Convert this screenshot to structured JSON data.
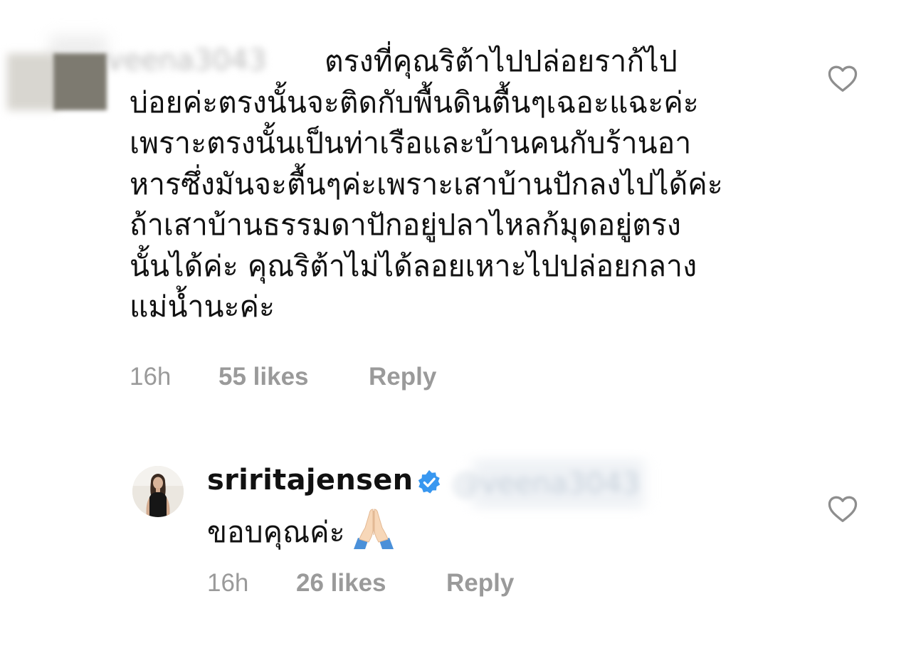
{
  "comment": {
    "username_blurred": "veena3043",
    "text_lines": [
      "ตรงที่คุณริต้าไปปล่อยราก้ไป",
      "บ่อยค่ะตรงนั้นจะติดกับพื้นดินตื้นๆเฉอะแฉะค่ะ",
      "เพราะตรงนั้นเป็นท่าเรือและบ้านคนกับร้านอา",
      "หารซึ่งมันจะตื้นๆค่ะเพราะเสาบ้านปักลงไปได้ค่ะ",
      "ถ้าเสาบ้านธรรมดาปักอยู่ปลาไหลก้มุดอยู่ตรง",
      "นั้นได้ค่ะ คุณริต้าไม่ได้ลอยเหาะไปปล่อยกลาง",
      "แม่น้ำนะค่ะ"
    ],
    "time": "16h",
    "likes": "55 likes",
    "reply_label": "Reply",
    "like_icon": "heart-outline-icon"
  },
  "reply": {
    "username": "sriritajensen",
    "verified_icon": "verified-badge-icon",
    "mention_blurred": "@veena3043",
    "text": "ขอบคุณค่ะ",
    "emoji": "folded-hands-emoji",
    "time": "16h",
    "likes": "26 likes",
    "reply_label": "Reply",
    "like_icon": "heart-outline-icon"
  },
  "colors": {
    "text": "#111111",
    "meta": "#9a9a9a",
    "verified_blue": "#3897f0",
    "heart_stroke": "#8e8e8e"
  }
}
